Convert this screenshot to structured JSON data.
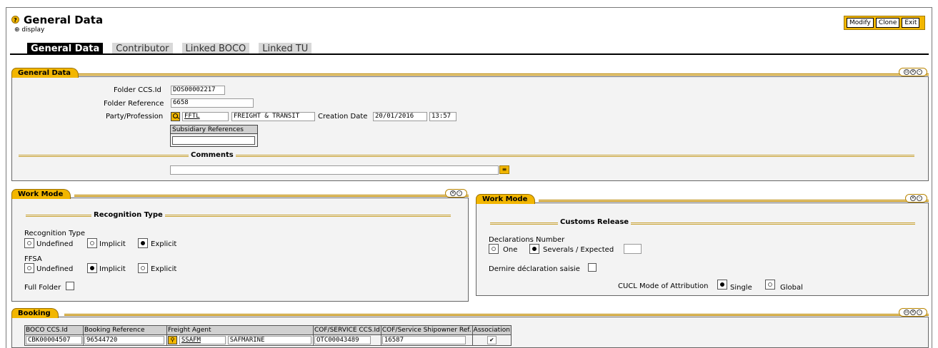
{
  "header": {
    "title": "General Data",
    "mode_label": "display",
    "actions": [
      "Modify",
      "Clone",
      "Exit"
    ]
  },
  "tabs": [
    "General Data",
    "Contributor",
    "Linked BOCO",
    "Linked TU"
  ],
  "general_data": {
    "panel_title": "General Data",
    "folder_ccs_id_label": "Folder CCS.Id",
    "folder_ccs_id": "DOS00002217",
    "folder_reference_label": "Folder Reference",
    "folder_reference": "6658",
    "party_profession_label": "Party/Profession",
    "party_code": "FFTL",
    "party_name": "FREIGHT & TRANSIT",
    "creation_date_label": "Creation Date",
    "creation_date": "20/01/2016",
    "creation_time": "13:57",
    "subsidiary_references_label": "Subsidiary References",
    "subsidiary_references_value": "",
    "comments_label": "Comments",
    "comments_value": ""
  },
  "work_mode_left": {
    "panel_title": "Work Mode",
    "section_title": "Recognition Type",
    "recognition_type_label": "Recognition Type",
    "recognition_options": [
      "Undefined",
      "Implicit",
      "Explicit"
    ],
    "recognition_selected": "Explicit",
    "ffsa_label": "FFSA",
    "ffsa_options": [
      "Undefined",
      "Implicit",
      "Explicit"
    ],
    "ffsa_selected": "Implicit",
    "full_folder_label": "Full Folder",
    "full_folder_checked": false
  },
  "work_mode_right": {
    "panel_title": "Work Mode",
    "section_title": "Customs Release",
    "declarations_number_label": "Declarations Number",
    "declarations_options": [
      "One",
      "Severals / Expected"
    ],
    "declarations_selected": "Severals / Expected",
    "declarations_count": "",
    "derniere_label": "Dernire déclaration saisie",
    "derniere_checked": false,
    "cucl_label": "CUCL Mode of Attribution",
    "cucl_options": [
      "Single",
      "Global"
    ],
    "cucl_selected": "Single"
  },
  "booking": {
    "panel_title": "Booking",
    "columns": [
      "BOCO CCS.Id",
      "Booking Reference",
      "Freight Agent",
      "COF/SERVICE CCS.Id",
      "COF/Service Shipowner Ref.",
      "Association"
    ],
    "rows": [
      {
        "boco_ccs_id": "CBK00004507",
        "booking_reference": "96544720",
        "agent_code": "SSAFM",
        "agent_name": "SAFMARINE",
        "cof_service_ccs_id": "OTC00043489",
        "shipowner_ref": "16587",
        "association": "✔"
      }
    ]
  },
  "colors": {
    "accent": "#f2b600",
    "panel_bg": "#f3f3f3",
    "active_tab_bg": "#000000",
    "inactive_tab_bg": "#d8d8d8"
  }
}
